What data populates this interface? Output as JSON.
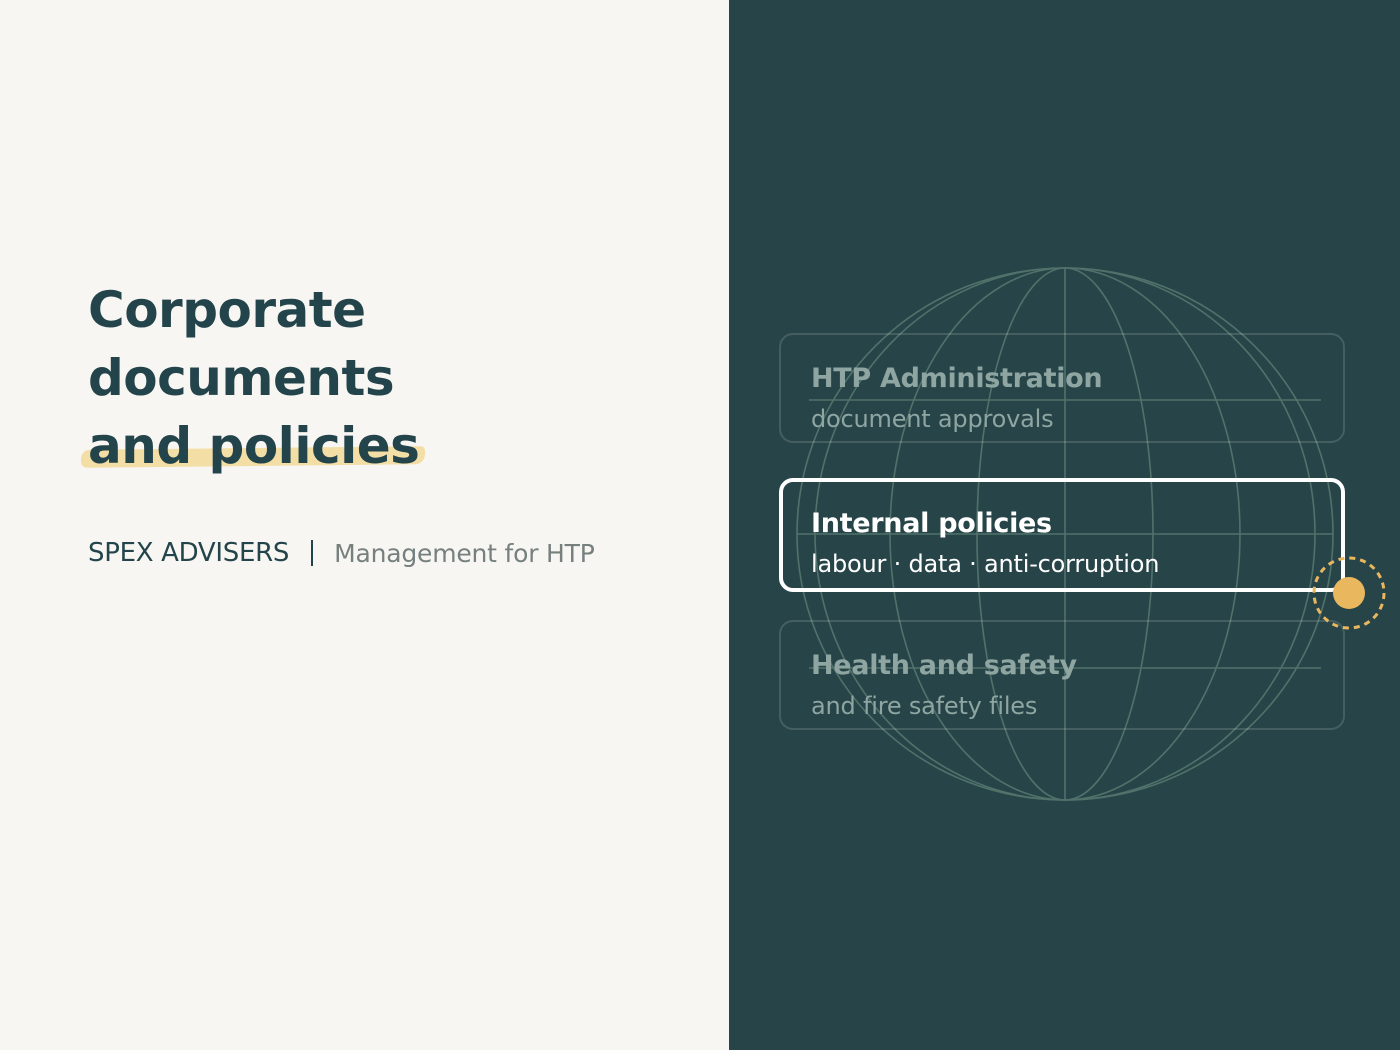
{
  "title": {
    "line1": "Corporate",
    "line2": "documents",
    "line3": "and policies"
  },
  "brand": {
    "name": "SPEX ADVISERS",
    "tagline": "Management for HTP"
  },
  "cards": [
    {
      "title": "HTP Administration",
      "subtitle": "document approvals",
      "active": false
    },
    {
      "title": "Internal policies",
      "subtitle": "labour · data · anti-corruption",
      "active": true
    },
    {
      "title": "Health and safety",
      "subtitle": "and fire safety files",
      "active": false
    }
  ],
  "colors": {
    "background_light": "#f8f6f2",
    "background_dark": "#274548",
    "text_dark": "#23444a",
    "accent_highlight": "#f2dc9c",
    "accent_indicator": "#e8b75e"
  },
  "icons": {
    "globe": "globe-icon",
    "indicator": "selection-indicator-icon"
  }
}
